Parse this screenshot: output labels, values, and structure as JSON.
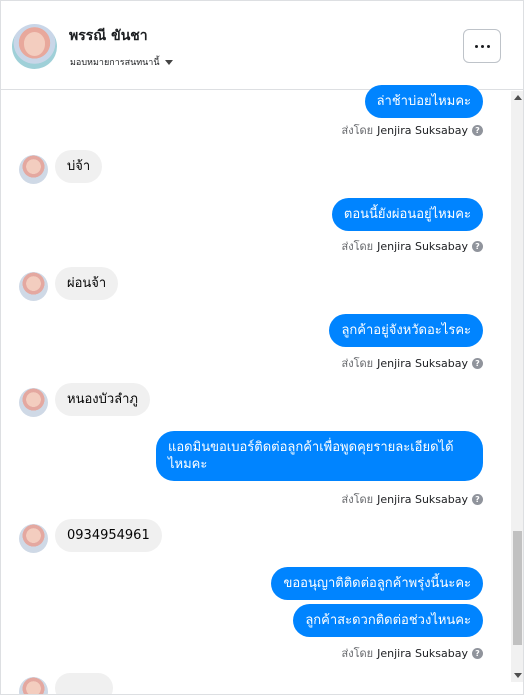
{
  "header": {
    "contact_name": "พรรณี ขันชา",
    "assign_label": "มอบหมายการสนทนานี้",
    "more_icon": "more-horizontal-icon"
  },
  "messages": {
    "m1": {
      "text": "ล่าช้าบ่อยไหมคะ"
    },
    "sent1": {
      "prefix": "ส่งโดย",
      "sender": "Jenjira Suksabay"
    },
    "m2": {
      "text": "บ่จ้า"
    },
    "m3": {
      "text": "ตอนนี้ยังผ่อนอยู่ไหมคะ"
    },
    "sent3": {
      "prefix": "ส่งโดย",
      "sender": "Jenjira Suksabay"
    },
    "m4": {
      "text": "ผ่อนจ้า"
    },
    "m5": {
      "text": "ลูกค้าอยู่จังหวัดอะไรคะ"
    },
    "sent5": {
      "prefix": "ส่งโดย",
      "sender": "Jenjira Suksabay"
    },
    "m6": {
      "text": "หนองบัวลำภู"
    },
    "m7": {
      "line1": "แอดมินขอเบอร์ติดต่อลูกค้าเพื่อพูดคุยรายละเอียดได้",
      "line2": "ไหมคะ"
    },
    "sent7": {
      "prefix": "ส่งโดย",
      "sender": "Jenjira Suksabay"
    },
    "m8": {
      "text": "0934954961"
    },
    "m9": {
      "text": "ขออนุญาติติดต่อลูกค้าพรุ่งนี้นะคะ"
    },
    "m10": {
      "text": "ลูกค้าสะดวกติดต่อช่วงไหนคะ"
    },
    "sent10": {
      "prefix": "ส่งโดย",
      "sender": "Jenjira Suksabay"
    }
  },
  "colors": {
    "outgoing_bubble": "#0084ff",
    "incoming_bubble": "#f0f0f0"
  }
}
